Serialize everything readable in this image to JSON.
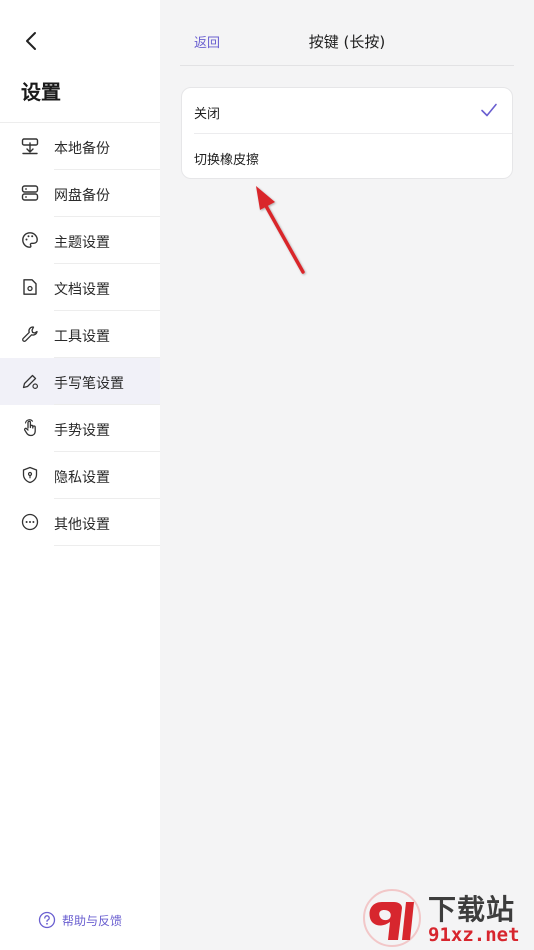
{
  "sidebar": {
    "title": "设置",
    "items": [
      {
        "label": "本地备份",
        "icon": "local-backup-icon",
        "active": false
      },
      {
        "label": "网盘备份",
        "icon": "cloud-backup-icon",
        "active": false
      },
      {
        "label": "主题设置",
        "icon": "palette-icon",
        "active": false
      },
      {
        "label": "文档设置",
        "icon": "document-gear-icon",
        "active": false
      },
      {
        "label": "工具设置",
        "icon": "wrench-icon",
        "active": false
      },
      {
        "label": "手写笔设置",
        "icon": "pen-gear-icon",
        "active": true
      },
      {
        "label": "手势设置",
        "icon": "hand-gesture-icon",
        "active": false
      },
      {
        "label": "隐私设置",
        "icon": "shield-lock-icon",
        "active": false
      },
      {
        "label": "其他设置",
        "icon": "more-dots-icon",
        "active": false
      }
    ],
    "help_label": "帮助与反馈"
  },
  "header": {
    "back_label": "返回",
    "title": "按键 (长按)"
  },
  "options": [
    {
      "label": "关闭",
      "selected": true
    },
    {
      "label": "切换橡皮擦",
      "selected": false
    }
  ],
  "watermark": {
    "title": "下载站",
    "url": "91xz.net"
  },
  "colors": {
    "accent": "#6a5fd0",
    "active_bg": "#f1f1f8",
    "arrow": "#d9262c"
  }
}
